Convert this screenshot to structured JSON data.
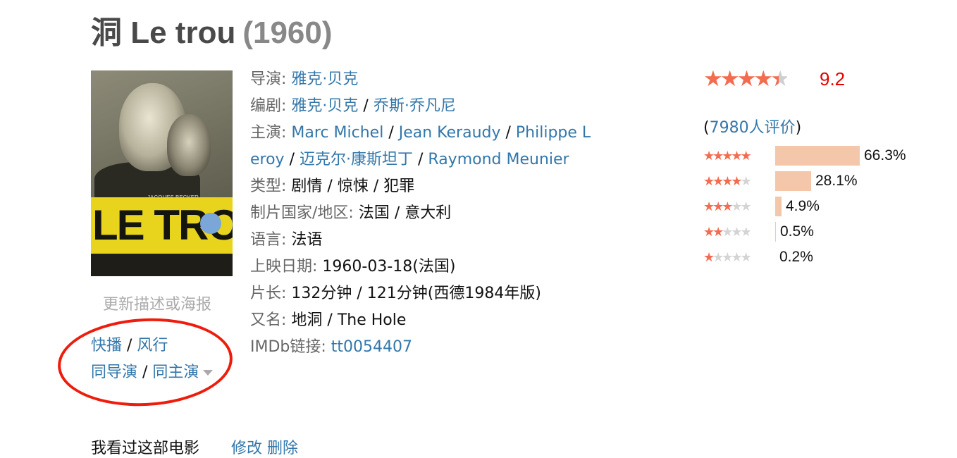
{
  "movie": {
    "title": "洞 Le trou",
    "year": "(1960)"
  },
  "poster": {
    "title_text": "LE TROU",
    "small_text": "JACQUES BECKER"
  },
  "update_link": "更新描述或海报",
  "watch_links": [
    "快播",
    "风行"
  ],
  "related_links": [
    "同导演",
    "同主演"
  ],
  "info": {
    "director_label": "导演",
    "director": "雅克·贝克",
    "writer_label": "编剧",
    "writers": [
      "雅克·贝克",
      "乔斯·乔凡尼"
    ],
    "cast_label": "主演",
    "cast_line1": [
      "Marc Michel",
      "Jean Keraudy",
      "Philippe L"
    ],
    "cast_line2": [
      "eroy",
      "迈克尔·康斯坦丁",
      "Raymond Meunier"
    ],
    "genre_label": "类型",
    "genre": "剧情 / 惊悚 / 犯罪",
    "country_label": "制片国家/地区",
    "country": "法国 / 意大利",
    "language_label": "语言",
    "language": "法语",
    "release_label": "上映日期",
    "release": "1960-03-18(法国)",
    "runtime_label": "片长",
    "runtime": "132分钟 / 121分钟(西德1984年版)",
    "aka_label": "又名",
    "aka": "地洞 / The Hole",
    "imdb_label": "IMDb链接",
    "imdb": "tt0054407"
  },
  "rating": {
    "score": "9.2",
    "stars_value": 4.5,
    "votes_open": "(",
    "votes_link": "7980人评价",
    "votes_close": ")",
    "distribution": [
      {
        "stars": 5,
        "percent_label": "66.3%",
        "percent": 66.3
      },
      {
        "stars": 4,
        "percent_label": "28.1%",
        "percent": 28.1
      },
      {
        "stars": 3,
        "percent_label": "4.9%",
        "percent": 4.9
      },
      {
        "stars": 2,
        "percent_label": "0.5%",
        "percent": 0.5
      },
      {
        "stars": 1,
        "percent_label": "0.2%",
        "percent": 0.2
      }
    ],
    "colors": {
      "star": "#f36c4f",
      "bar": "#f4c7ab",
      "score": "#e60000"
    }
  },
  "seen": {
    "text": "我看过这部电影",
    "edit": "修改",
    "delete": "删除"
  }
}
